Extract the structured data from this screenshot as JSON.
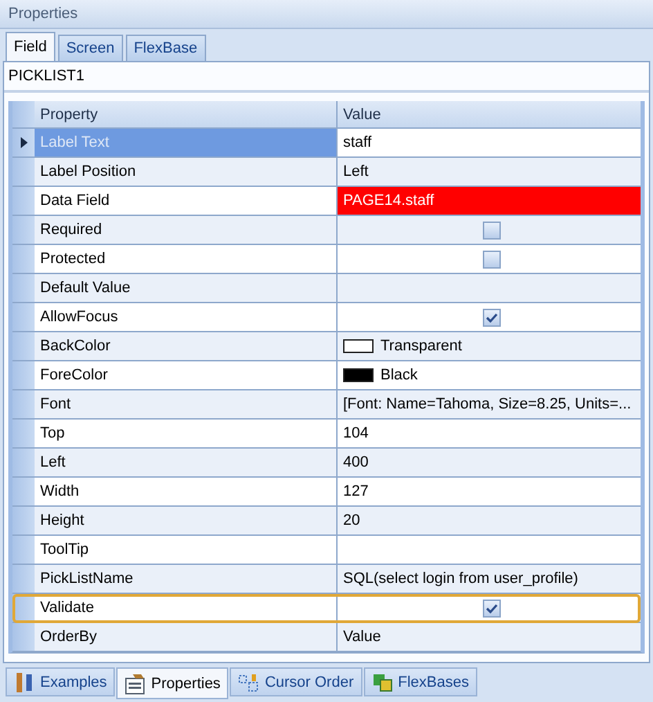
{
  "panel": {
    "title": "Properties"
  },
  "tabs": [
    {
      "label": "Field",
      "selected": true
    },
    {
      "label": "Screen",
      "selected": false
    },
    {
      "label": "FlexBase",
      "selected": false
    }
  ],
  "object_name": "PICKLIST1",
  "grid": {
    "columns": [
      "Property",
      "Value"
    ],
    "rows": [
      {
        "property": "Label Text",
        "kind": "text",
        "value": "staff",
        "selected": true,
        "invalid": false,
        "focused": false
      },
      {
        "property": "Label Position",
        "kind": "text",
        "value": "Left",
        "selected": false,
        "invalid": false,
        "focused": false
      },
      {
        "property": "Data Field",
        "kind": "text",
        "value": "PAGE14.staff",
        "selected": false,
        "invalid": true,
        "focused": false
      },
      {
        "property": "Required",
        "kind": "checkbox",
        "checked": false,
        "selected": false,
        "invalid": false,
        "focused": false
      },
      {
        "property": "Protected",
        "kind": "checkbox",
        "checked": false,
        "selected": false,
        "invalid": false,
        "focused": false
      },
      {
        "property": "Default Value",
        "kind": "text",
        "selected": false,
        "invalid": false,
        "focused": false
      },
      {
        "property": "AllowFocus",
        "kind": "checkbox",
        "checked": true,
        "selected": false,
        "invalid": false,
        "focused": false
      },
      {
        "property": "BackColor",
        "kind": "color",
        "value": "Transparent",
        "color": "#ffffff",
        "selected": false,
        "invalid": false,
        "focused": false
      },
      {
        "property": "ForeColor",
        "kind": "color",
        "value": "Black",
        "color": "#000000",
        "selected": false,
        "invalid": false,
        "focused": false
      },
      {
        "property": "Font",
        "kind": "text",
        "value": "[Font: Name=Tahoma, Size=8.25, Units=...",
        "selected": false,
        "invalid": false,
        "focused": false
      },
      {
        "property": "Top",
        "kind": "text",
        "value": "104",
        "selected": false,
        "invalid": false,
        "focused": false
      },
      {
        "property": "Left",
        "kind": "text",
        "value": "400",
        "selected": false,
        "invalid": false,
        "focused": false
      },
      {
        "property": "Width",
        "kind": "text",
        "value": "127",
        "selected": false,
        "invalid": false,
        "focused": false
      },
      {
        "property": "Height",
        "kind": "text",
        "value": "20",
        "selected": false,
        "invalid": false,
        "focused": false
      },
      {
        "property": "ToolTip",
        "kind": "text",
        "selected": false,
        "invalid": false,
        "focused": false
      },
      {
        "property": "PickListName",
        "kind": "text",
        "value": "SQL(select login from user_profile)",
        "selected": false,
        "invalid": false,
        "focused": false
      },
      {
        "property": "Validate",
        "kind": "checkbox",
        "checked": true,
        "selected": false,
        "invalid": false,
        "focused": true
      },
      {
        "property": "OrderBy",
        "kind": "text",
        "value": "Value",
        "selected": false,
        "invalid": false,
        "focused": false
      }
    ]
  },
  "bottom_tabs": [
    {
      "label": "Examples",
      "selected": false
    },
    {
      "label": "Properties",
      "selected": true
    },
    {
      "label": "Cursor Order",
      "selected": false
    },
    {
      "label": "FlexBases",
      "selected": false
    }
  ]
}
